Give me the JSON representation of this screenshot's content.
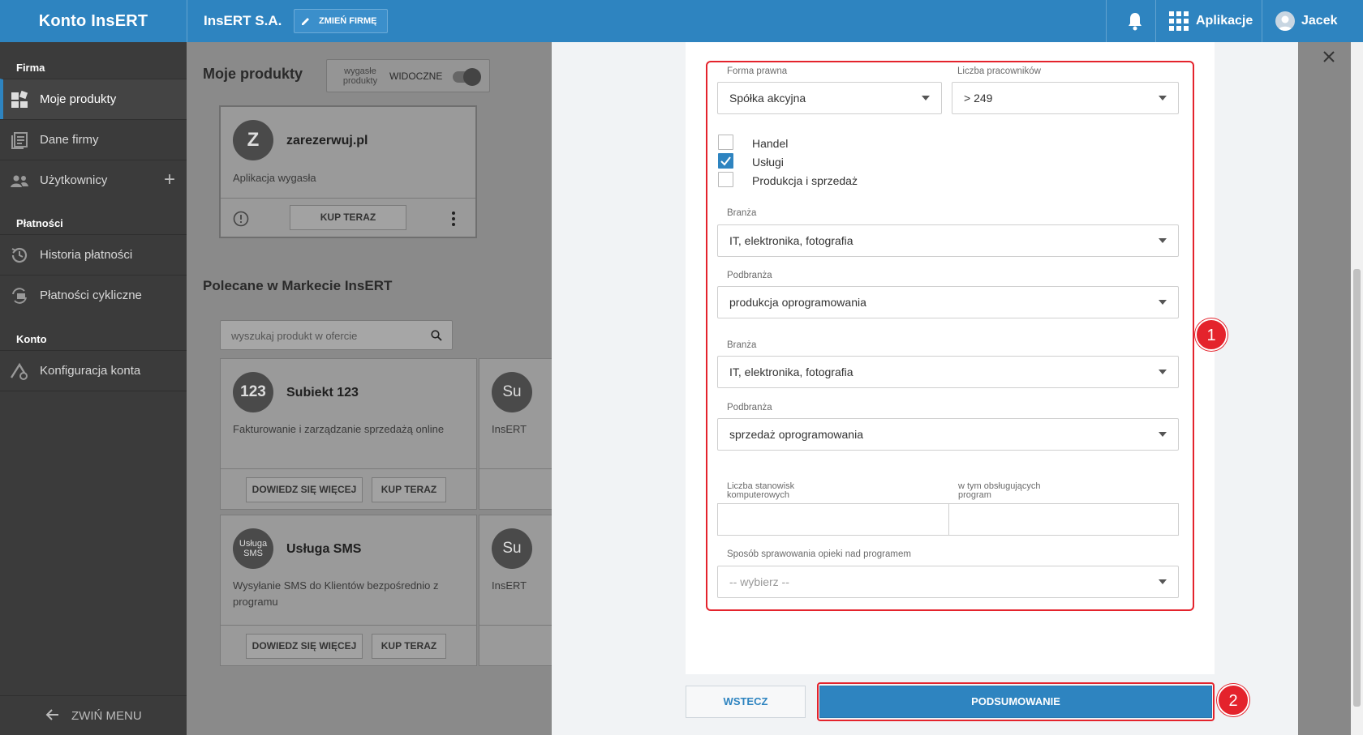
{
  "topbar": {
    "brand": "Konto InsERT",
    "company": "InsERT S.A.",
    "change_company": "ZMIEŃ FIRMĘ",
    "apps": "Aplikacje",
    "user": "Jacek"
  },
  "sidebar": {
    "section_company": "Firma",
    "my_products": "Moje produkty",
    "company_data": "Dane firmy",
    "users": "Użytkownicy",
    "section_payments": "Płatności",
    "payment_history": "Historia płatności",
    "recurring_payments": "Płatności cykliczne",
    "section_account": "Konto",
    "account_config": "Konfiguracja konta",
    "collapse": "ZWIŃ MENU"
  },
  "main": {
    "my_products_title": "Moje produkty",
    "toggle_expired": "wygasłe produkty",
    "toggle_visible": "WIDOCZNE",
    "product": {
      "logo": "Z",
      "name": "zarezerwuj.pl",
      "status": "Aplikacja wygasła",
      "buy": "KUP TERAZ"
    },
    "recommended_title": "Polecane w Markecie InsERT",
    "search_placeholder": "wyszukaj produkt w ofercie",
    "cards": [
      {
        "logo": "123",
        "name": "Subiekt 123",
        "desc": "Fakturowanie i zarządzanie sprzedażą online",
        "learn": "DOWIEDZ SIĘ WIĘCEJ",
        "buy": "KUP TERAZ"
      },
      {
        "logo": "Su",
        "desc": "InsERT"
      },
      {
        "logo": "Usługa SMS",
        "name": "Usługa SMS",
        "desc": "Wysyłanie SMS do Klientów bezpośrednio z programu",
        "learn": "DOWIEDZ SIĘ WIĘCEJ",
        "buy": "KUP TERAZ"
      },
      {
        "logo": "Su",
        "desc": "InsERT"
      }
    ]
  },
  "form": {
    "legal_form_label": "Forma prawna",
    "legal_form_value": "Spółka akcyjna",
    "employees_label": "Liczba pracowników",
    "employees_value": "> 249",
    "checkboxes": [
      {
        "label": "Handel",
        "checked": false
      },
      {
        "label": "Usługi",
        "checked": true
      },
      {
        "label": "Produkcja i sprzedaż",
        "checked": false
      }
    ],
    "industry1_label": "Branża",
    "industry1_value": "IT, elektronika, fotografia",
    "subindustry1_label": "Podbranża",
    "subindustry1_value": "produkcja oprogramowania",
    "industry2_label": "Branża",
    "industry2_value": "IT, elektronika, fotografia",
    "subindustry2_label": "Podbranża",
    "subindustry2_value": "sprzedaż oprogramowania",
    "workstations_label": "Liczba stanowisk komputerowych",
    "program_users_label": "w tym obsługujących program",
    "care_label": "Sposób sprawowania opieki nad programem",
    "care_placeholder": "-- wybierz --",
    "back": "WSTECZ",
    "summary": "PODSUMOWANIE"
  },
  "annotations": {
    "one": "1",
    "two": "2"
  },
  "colors": {
    "primary": "#2e84c0",
    "highlight": "#e4232c",
    "sidebar": "#3b3b3b"
  }
}
